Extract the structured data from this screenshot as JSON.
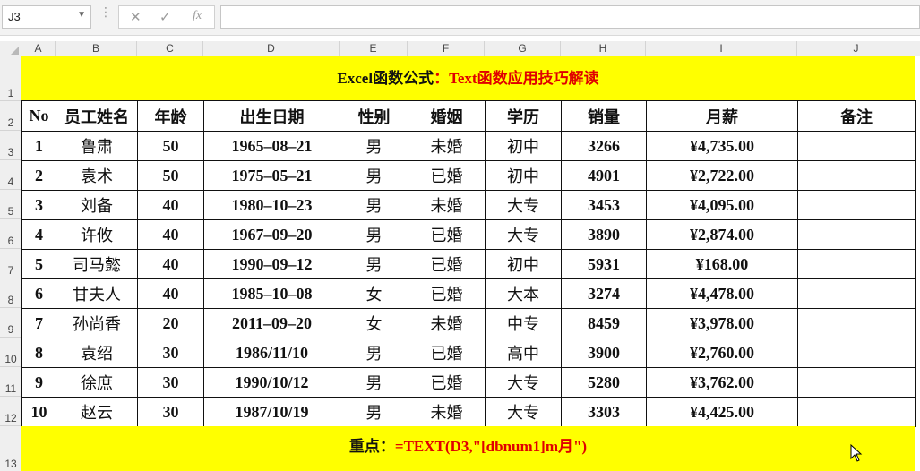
{
  "formula_bar": {
    "name_box": "J3",
    "cancel_glyph": "✕",
    "enter_glyph": "✓",
    "fx_glyph": "fx",
    "formula": ""
  },
  "columns": [
    "A",
    "B",
    "C",
    "D",
    "E",
    "F",
    "G",
    "H",
    "I",
    "J"
  ],
  "rows": [
    "1",
    "2",
    "3",
    "4",
    "5",
    "6",
    "7",
    "8",
    "9",
    "10",
    "11",
    "12",
    "13"
  ],
  "title": {
    "black": "Excel函数公式",
    "red": "：Text函数应用技巧解读"
  },
  "table": {
    "headers": [
      "No",
      "员工姓名",
      "年龄",
      "出生日期",
      "性别",
      "婚姻",
      "学历",
      "销量",
      "月薪",
      "备注"
    ],
    "rows": [
      [
        "1",
        "鲁肃",
        "50",
        "1965–08–21",
        "男",
        "未婚",
        "初中",
        "3266",
        "¥4,735.00",
        ""
      ],
      [
        "2",
        "袁术",
        "50",
        "1975–05–21",
        "男",
        "已婚",
        "初中",
        "4901",
        "¥2,722.00",
        ""
      ],
      [
        "3",
        "刘备",
        "40",
        "1980–10–23",
        "男",
        "未婚",
        "大专",
        "3453",
        "¥4,095.00",
        ""
      ],
      [
        "4",
        "许攸",
        "40",
        "1967–09–20",
        "男",
        "已婚",
        "大专",
        "3890",
        "¥2,874.00",
        ""
      ],
      [
        "5",
        "司马懿",
        "40",
        "1990–09–12",
        "男",
        "已婚",
        "初中",
        "5931",
        "¥168.00",
        ""
      ],
      [
        "6",
        "甘夫人",
        "40",
        "1985–10–08",
        "女",
        "已婚",
        "大本",
        "3274",
        "¥4,478.00",
        ""
      ],
      [
        "7",
        "孙尚香",
        "20",
        "2011–09–20",
        "女",
        "未婚",
        "中专",
        "8459",
        "¥3,978.00",
        ""
      ],
      [
        "8",
        "袁绍",
        "30",
        "1986/11/10",
        "男",
        "已婚",
        "高中",
        "3900",
        "¥2,760.00",
        ""
      ],
      [
        "9",
        "徐庶",
        "30",
        "1990/10/12",
        "男",
        "已婚",
        "大专",
        "5280",
        "¥3,762.00",
        ""
      ],
      [
        "10",
        "赵云",
        "30",
        "1987/10/19",
        "男",
        "未婚",
        "大专",
        "3303",
        "¥4,425.00",
        ""
      ]
    ]
  },
  "footer": {
    "black": "重点：",
    "red": "=TEXT(D3,\"[dbnum1]m月\")"
  },
  "colors": {
    "banner": "#ffff00",
    "accent_red": "#e00000"
  },
  "icons": {
    "name_box_dropdown": "chevron-down-icon",
    "cancel": "cancel-icon",
    "enter": "check-icon",
    "insert_function": "fx-icon",
    "mouse_pointer": "cursor-arrow-icon"
  }
}
